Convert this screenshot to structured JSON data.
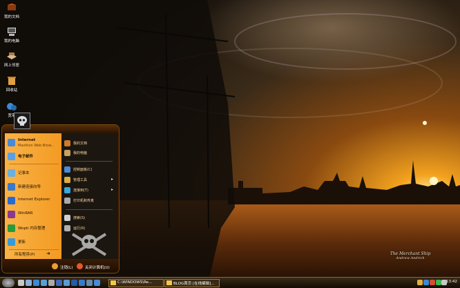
{
  "desktop_icons": [
    {
      "label": "我的文档",
      "icon": "folder-documents-icon"
    },
    {
      "label": "我的电脑",
      "icon": "computer-icon"
    },
    {
      "label": "网上邻居",
      "icon": "network-icon"
    },
    {
      "label": "回收站",
      "icon": "recycle-bin-icon"
    },
    {
      "label": "宽带",
      "icon": "broadband-icon"
    }
  ],
  "start_menu": {
    "pinned": [
      {
        "title": "Internet",
        "subtitle": "Maxthon Web Brow...",
        "icon": "browser-icon",
        "color": "#4a88d8"
      },
      {
        "title": "电子邮件",
        "subtitle": "",
        "icon": "email-icon",
        "color": "#5aa0e8"
      }
    ],
    "recent": [
      {
        "title": "记事本",
        "icon": "notepad-icon",
        "color": "#6ab0e0"
      },
      {
        "title": "新建连接向导",
        "icon": "connection-wizard-icon",
        "color": "#3a78c8"
      },
      {
        "title": "Internet Explorer",
        "icon": "ie-icon",
        "color": "#2a6ad0"
      },
      {
        "title": "WinRAR",
        "icon": "winrar-icon",
        "color": "#8a3a8a"
      },
      {
        "title": "Wopti 内存整理",
        "icon": "memory-tool-icon",
        "color": "#2a9a3a"
      },
      {
        "title": "更新",
        "icon": "update-icon",
        "color": "#3a9ad8"
      }
    ],
    "all_programs": "所有程序(P)",
    "right_items": [
      {
        "title": "我的文档",
        "icon": "my-documents-icon",
        "color": "#d07a2a",
        "arrow": false
      },
      {
        "title": "我的电脑",
        "icon": "my-computer-icon",
        "color": "#c8a060",
        "arrow": false
      },
      {
        "title": "控制面板(C)",
        "icon": "control-panel-icon",
        "color": "#4a8ad8",
        "arrow": false
      },
      {
        "title": "管理工具",
        "icon": "admin-tools-icon",
        "color": "#d8b040",
        "arrow": true
      },
      {
        "title": "连接到(T)",
        "icon": "connect-icon",
        "color": "#3aa8d8",
        "arrow": true
      },
      {
        "title": "打印机和传真",
        "icon": "printer-icon",
        "color": "#aaaaaa",
        "arrow": false
      },
      {
        "title": "搜索(S)",
        "icon": "search-icon",
        "color": "#d0d0d0",
        "arrow": false
      },
      {
        "title": "运行(R)",
        "icon": "run-icon",
        "color": "#b0b0b0",
        "arrow": false
      }
    ],
    "footer": {
      "logoff": "注销(L)",
      "shutdown": "关闭计算机(U)"
    }
  },
  "taskbar": {
    "tasks": [
      {
        "title": "C:\\WINDOWS\\Re..."
      },
      {
        "title": "BLOG首页 [在线编辑]..."
      }
    ],
    "clock": "13:42"
  },
  "watermark": {
    "line1": "The Merchant Ship",
    "line2": "Andrew Andrich"
  },
  "colors": {
    "menu_orange": "#f7a12c",
    "menu_dark": "#1b1610",
    "taskbar": "#2a1d0c"
  }
}
